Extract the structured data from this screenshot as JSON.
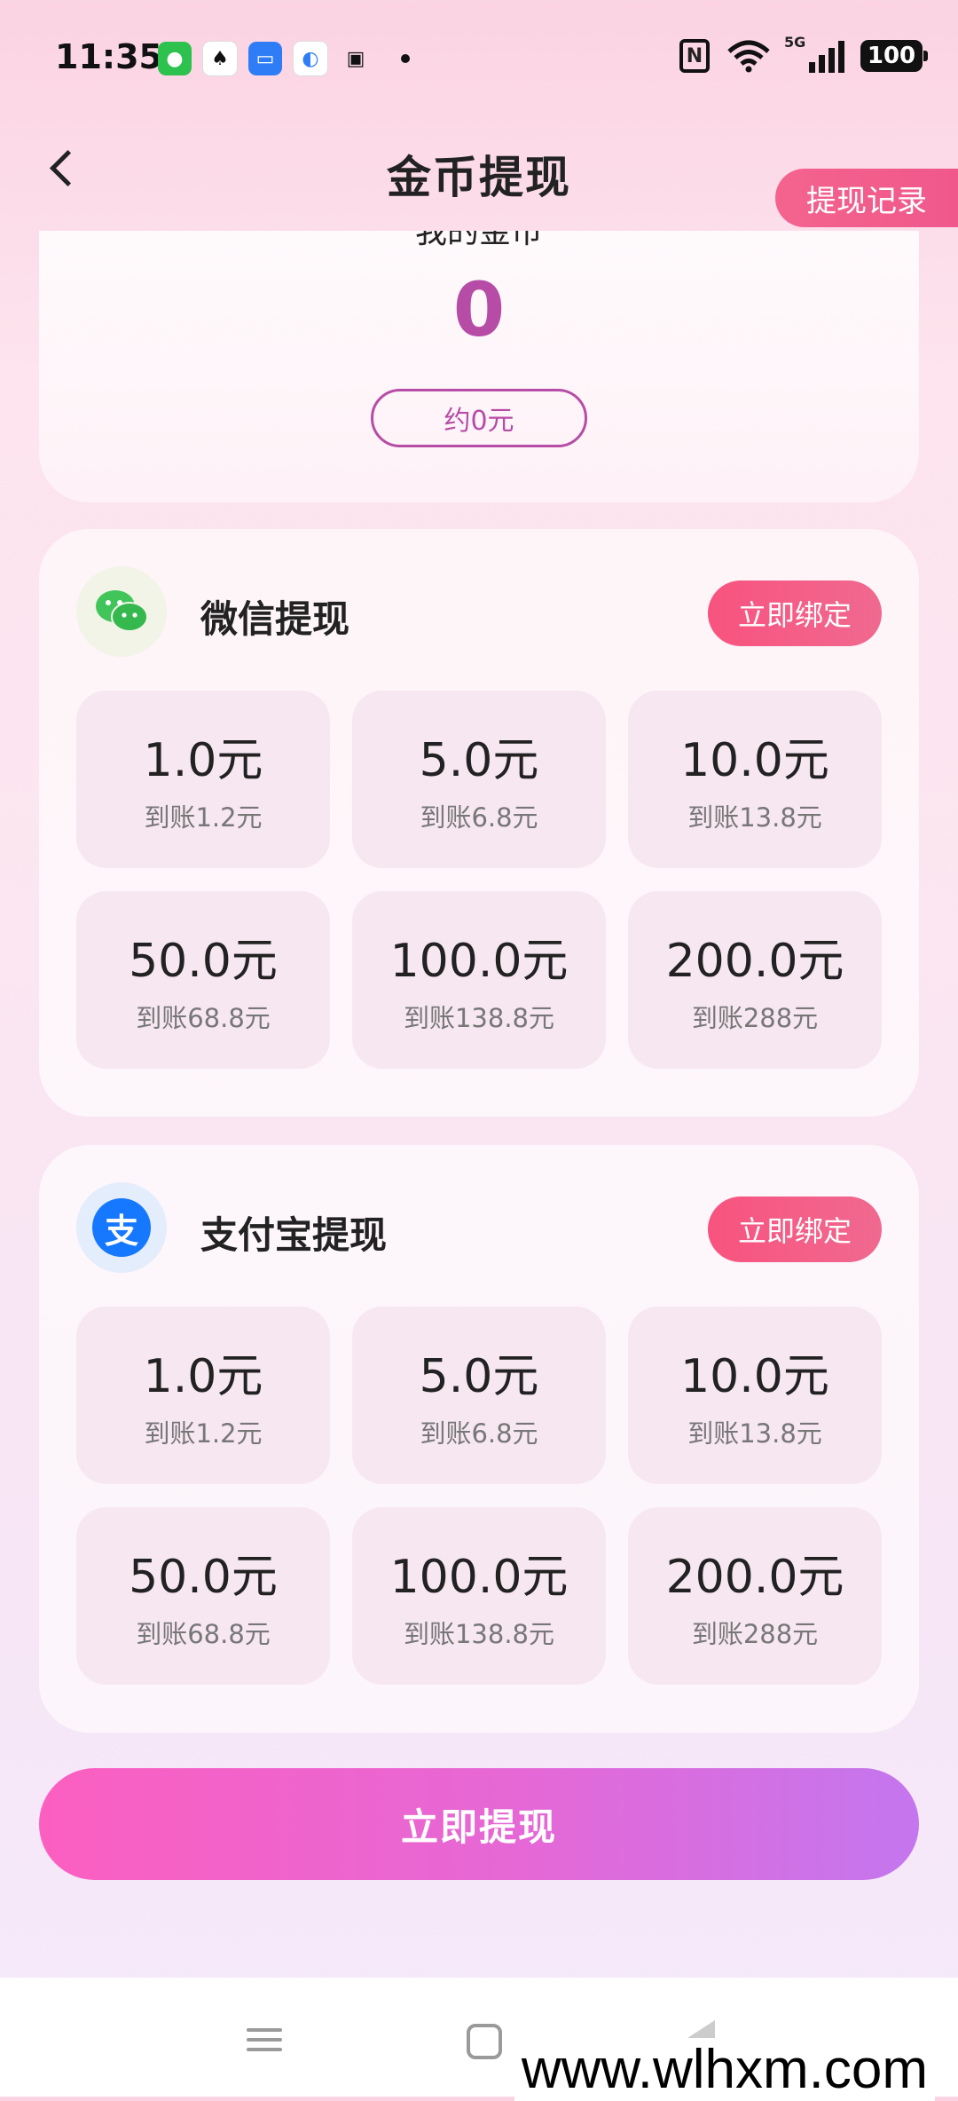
{
  "status_bar": {
    "time": "11:35",
    "battery": "100",
    "network": "5G",
    "app_icons": [
      "wechat-icon",
      "qq-icon",
      "messages-icon",
      "browser-icon",
      "bag-icon"
    ]
  },
  "header": {
    "title": "金币提现",
    "record_label": "提现记录"
  },
  "coins": {
    "label": "我的金币",
    "value": "0",
    "approx": "约0元"
  },
  "wechat": {
    "title": "微信提现",
    "bind_label": "立即绑定",
    "icon": "wechat-icon",
    "options": [
      {
        "amount": "1.0元",
        "arrive": "到账1.2元"
      },
      {
        "amount": "5.0元",
        "arrive": "到账6.8元"
      },
      {
        "amount": "10.0元",
        "arrive": "到账13.8元"
      },
      {
        "amount": "50.0元",
        "arrive": "到账68.8元"
      },
      {
        "amount": "100.0元",
        "arrive": "到账138.8元"
      },
      {
        "amount": "200.0元",
        "arrive": "到账288元"
      }
    ]
  },
  "alipay": {
    "title": "支付宝提现",
    "bind_label": "立即绑定",
    "icon": "alipay-icon",
    "icon_glyph": "支",
    "options": [
      {
        "amount": "1.0元",
        "arrive": "到账1.2元"
      },
      {
        "amount": "5.0元",
        "arrive": "到账6.8元"
      },
      {
        "amount": "10.0元",
        "arrive": "到账13.8元"
      },
      {
        "amount": "50.0元",
        "arrive": "到账68.8元"
      },
      {
        "amount": "100.0元",
        "arrive": "到账138.8元"
      },
      {
        "amount": "200.0元",
        "arrive": "到账288元"
      }
    ]
  },
  "withdraw_button": "立即提现",
  "watermark": "www.wlhxm.com",
  "colors": {
    "accent_pink": "#f4638e",
    "coin_purple": "#b64ca6",
    "button_gradient_start": "#fb5fc0",
    "button_gradient_end": "#c476ee"
  }
}
